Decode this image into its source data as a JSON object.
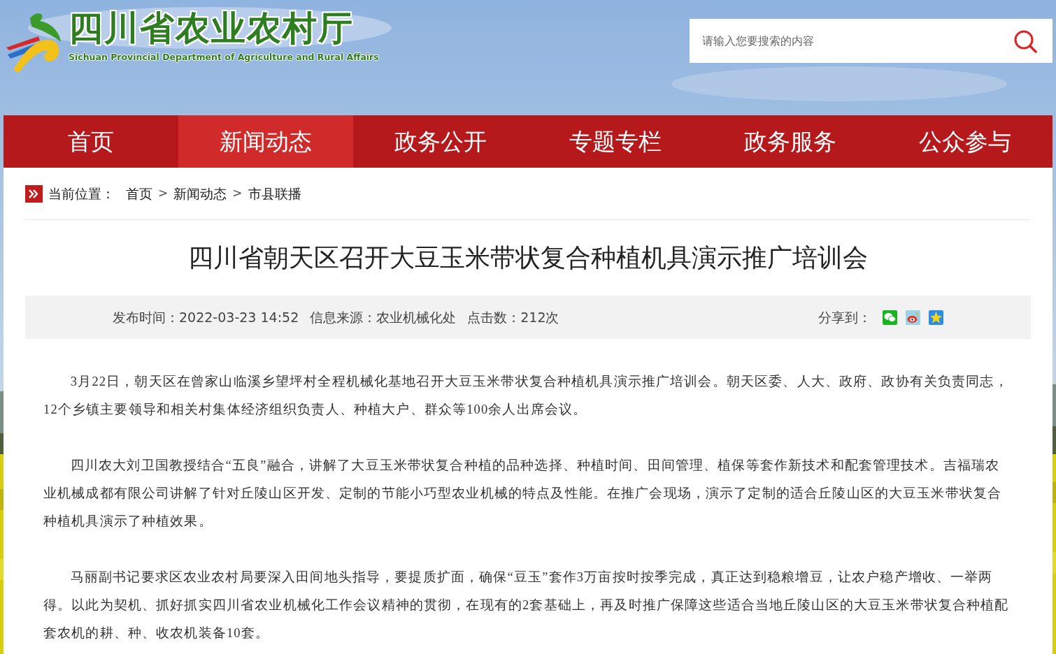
{
  "header": {
    "logo_title": "四川省农业农村厅",
    "logo_subtitle": "Sichuan Provincial Department of Agriculture and Rural Affairs",
    "search": {
      "placeholder": "请输入您要搜索的内容"
    }
  },
  "nav": [
    {
      "label": "首页",
      "selected": false
    },
    {
      "label": "新闻动态",
      "selected": true
    },
    {
      "label": "政务公开",
      "selected": false
    },
    {
      "label": "专题专栏",
      "selected": false
    },
    {
      "label": "政务服务",
      "selected": false
    },
    {
      "label": "公众参与",
      "selected": false
    }
  ],
  "breadcrumb": {
    "label": "当前位置：",
    "items": [
      {
        "kind": "link",
        "text": "首页"
      },
      {
        "kind": "separator",
        "text": ">"
      },
      {
        "kind": "link",
        "text": "新闻动态"
      },
      {
        "kind": "separator",
        "text": ">"
      },
      {
        "kind": "link",
        "text": "市县联播"
      }
    ]
  },
  "article": {
    "title": "四川省朝天区召开大豆玉米带状复合种植机具演示推广培训会",
    "meta": [
      "发布时间：2022-03-23 14:52",
      "信息来源：农业机械化处",
      "点击数：212次"
    ],
    "share_label": "分享到：",
    "paragraphs": [
      "3月22日，朝天区在曾家山临溪乡望坪村全程机械化基地召开大豆玉米带状复合种植机具演示推广培训会。朝天区委、人大、政府、政协有关负责同志，12个乡镇主要领导和相关村集体经济组织负责人、种植大户、群众等100余人出席会议。",
      "四川农大刘卫国教授结合“五良”融合，讲解了大豆玉米带状复合种植的品种选择、种植时间、田间管理、植保等套作新技术和配套管理技术。吉福瑞农业机械成都有限公司讲解了针对丘陵山区开发、定制的节能小巧型农业机械的特点及性能。在推广会现场，演示了定制的适合丘陵山区的大豆玉米带状复合种植机具演示了种植效果。",
      "马丽副书记要求区农业农村局要深入田间地头指导，要提质扩面，确保“豆玉”套作3万亩按时按季完成，真正达到稳粮增豆，让农户稳产增收、一举两得。以此为契机、抓好抓实四川省农业机械化工作会议精神的贯彻，在现有的2套基础上，再及时推广保障这些适合当地丘陵山区的大豆玉米带状复合种植配套农机的耕、种、收农机装备10套。"
    ]
  }
}
